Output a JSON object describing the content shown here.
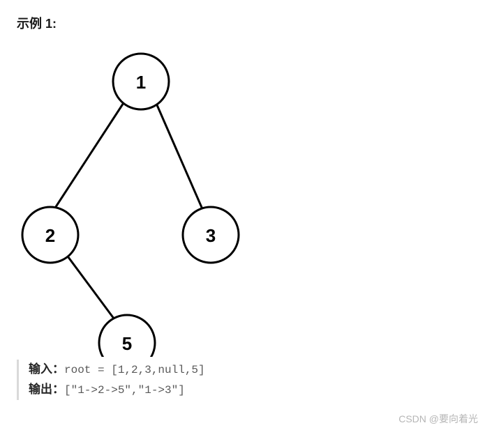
{
  "heading": "示例 1:",
  "tree": {
    "nodes": {
      "n1": "1",
      "n2": "2",
      "n3": "3",
      "n5": "5"
    }
  },
  "io": {
    "input_label": "输入：",
    "input_value": "root = [1,2,3,null,5]",
    "output_label": "输出：",
    "output_value": "[\"1->2->5\",\"1->3\"]"
  },
  "watermark": "CSDN @要向着光"
}
